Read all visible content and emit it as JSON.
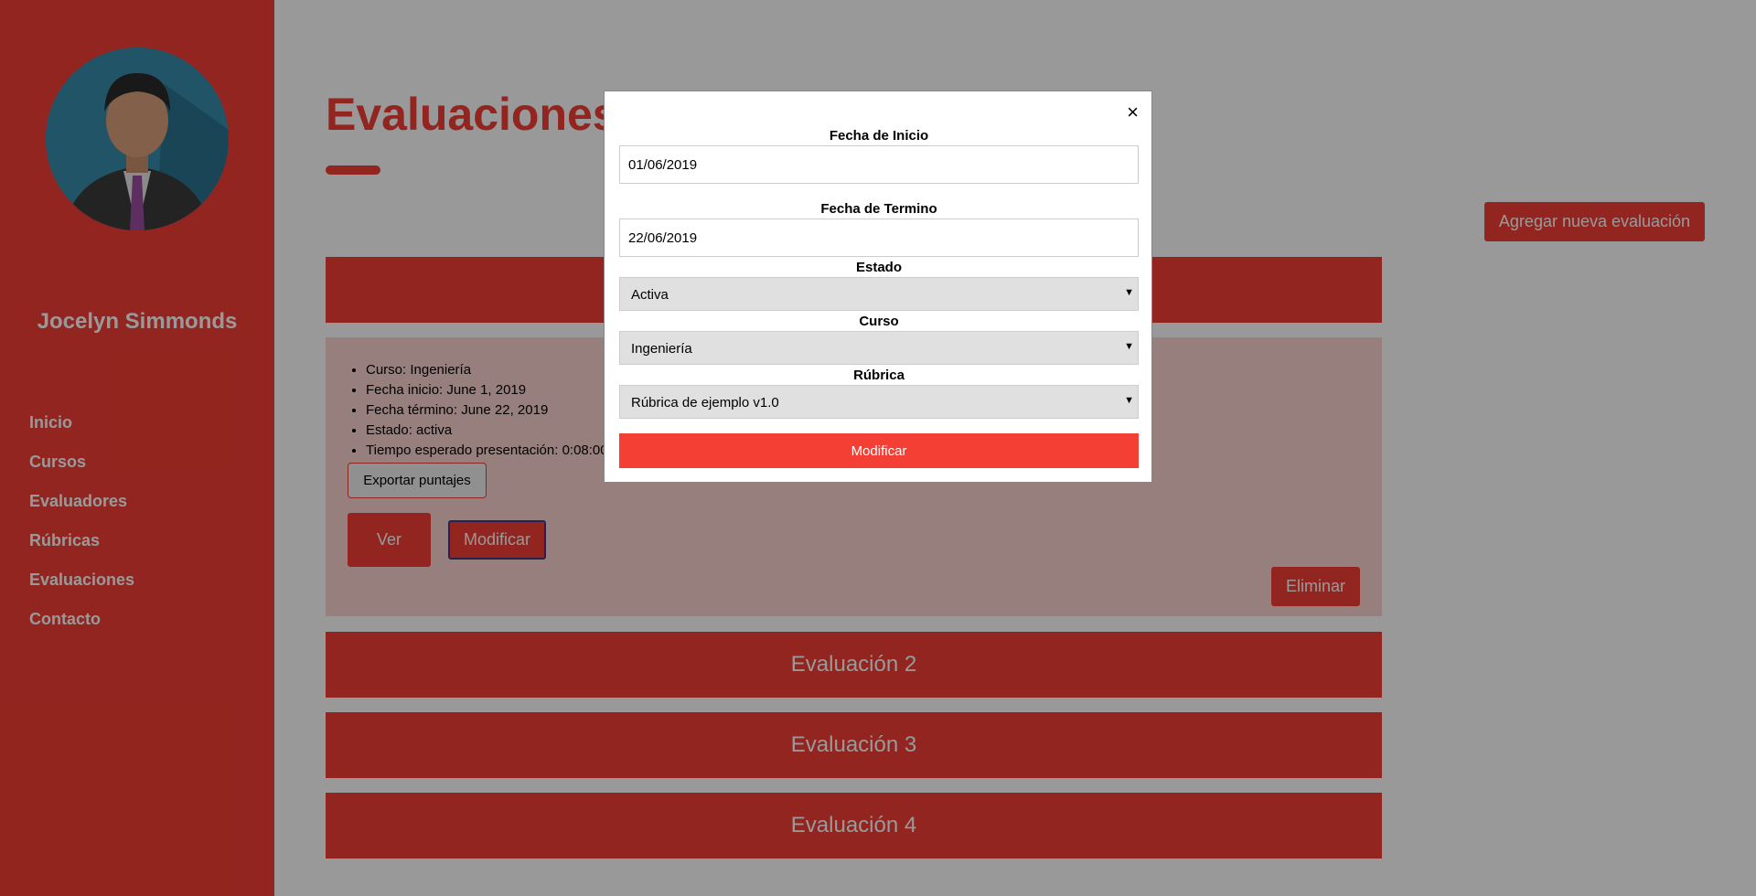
{
  "sidebar": {
    "profile_name": "Jocelyn Simmonds",
    "nav": [
      "Inicio",
      "Cursos",
      "Evaluadores",
      "Rúbricas",
      "Evaluaciones",
      "Contacto"
    ]
  },
  "main": {
    "title": "Evaluaciones",
    "add_button": "Agregar nueva evaluación",
    "evaluation_1": {
      "details": [
        "Curso: Ingeniería",
        "Fecha inicio: June 1, 2019",
        "Fecha término: June 22, 2019",
        "Estado: activa",
        "Tiempo esperado presentación: 0:08:00"
      ],
      "export_button": "Exportar puntajes",
      "view_button": "Ver",
      "edit_button": "Modificar",
      "delete_button": "Eliminar"
    },
    "evaluations": [
      "Evaluación 2",
      "Evaluación 3",
      "Evaluación 4"
    ]
  },
  "modal": {
    "close": "×",
    "start_date_label": "Fecha de Inicio",
    "start_date_value": "01/06/2019",
    "end_date_label": "Fecha de Termino",
    "end_date_value": "22/06/2019",
    "status_label": "Estado",
    "status_value": "Activa",
    "course_label": "Curso",
    "course_value": "Ingeniería",
    "rubric_label": "Rúbrica",
    "rubric_value": "Rúbrica de ejemplo v1.0",
    "submit_button": "Modificar"
  },
  "colors": {
    "primary": "#f33f34",
    "overlay": "rgba(0,0,0,0.4)"
  }
}
